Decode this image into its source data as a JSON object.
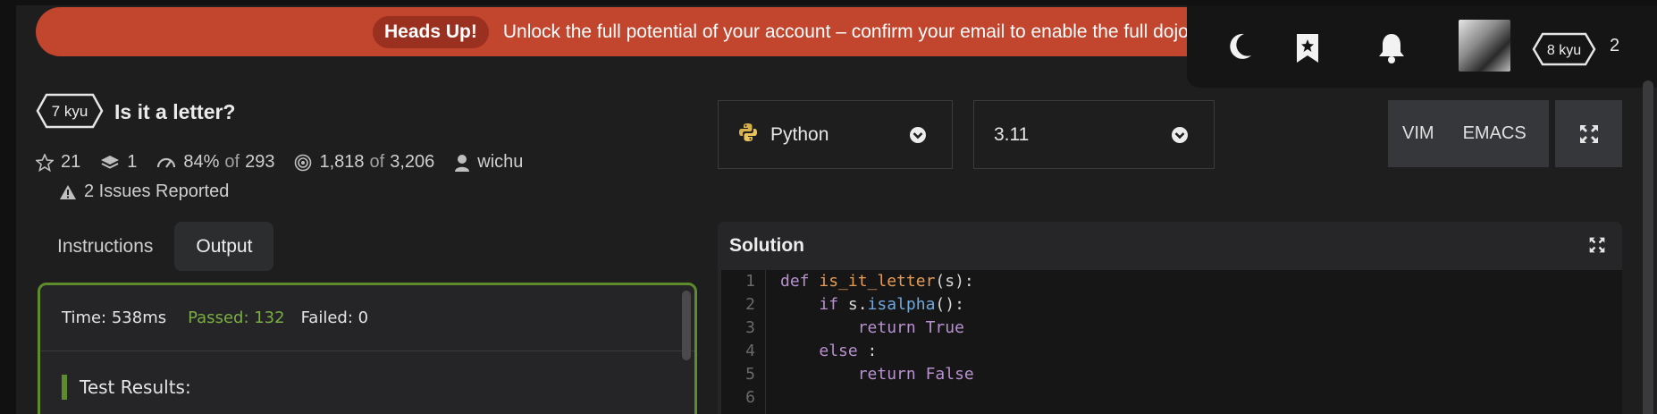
{
  "banner": {
    "badge": "Heads Up!",
    "text": "Unlock the full potential of your account – confirm your email to enable the full dojo e"
  },
  "topbar": {
    "icons": [
      "moon-icon",
      "bookmark-star-icon",
      "bell-icon"
    ],
    "rank": "8 kyu",
    "honor": "2"
  },
  "kata": {
    "rank": "7 kyu",
    "title": "Is it a letter?",
    "stars": "21",
    "collections": "1",
    "satisfaction_pct": "84%",
    "satisfaction_of": "of",
    "satisfaction_votes": "293",
    "completed": "1,818",
    "completed_of": "of",
    "completed_total": "3,206",
    "author": "wichu",
    "issues": "2 Issues Reported"
  },
  "tabs": [
    {
      "label": "Instructions",
      "active": false
    },
    {
      "label": "Output",
      "active": true
    }
  ],
  "output": {
    "time": "Time: 538ms",
    "passed": "Passed: 132",
    "failed": "Failed: 0",
    "results_label": "Test Results:"
  },
  "editor_controls": {
    "language": "Python",
    "version": "3.11",
    "mode_vim": "VIM",
    "mode_emacs": "EMACS"
  },
  "solution": {
    "title": "Solution",
    "line_numbers": [
      "1",
      "2",
      "3",
      "4",
      "5",
      "6"
    ],
    "code": {
      "l1_kw": "def",
      "l1_fn": "is_it_letter",
      "l1_rest": "(s):",
      "l2_indent": "    ",
      "l2_kw": "if",
      "l2_obj": " s.",
      "l2_method": "isalpha",
      "l2_rest": "():",
      "l3_indent": "        ",
      "l3_kw": "return",
      "l3_val": " True",
      "l4_indent": "    ",
      "l4_kw": "else",
      "l4_rest": " :",
      "l5_indent": "        ",
      "l5_kw": "return",
      "l5_val": " False"
    }
  },
  "colors": {
    "banner": "#c2452e",
    "passed": "#79ad43",
    "output_border": "#5e8b2b",
    "keyword": "#b891cf",
    "function": "#e59b55"
  }
}
